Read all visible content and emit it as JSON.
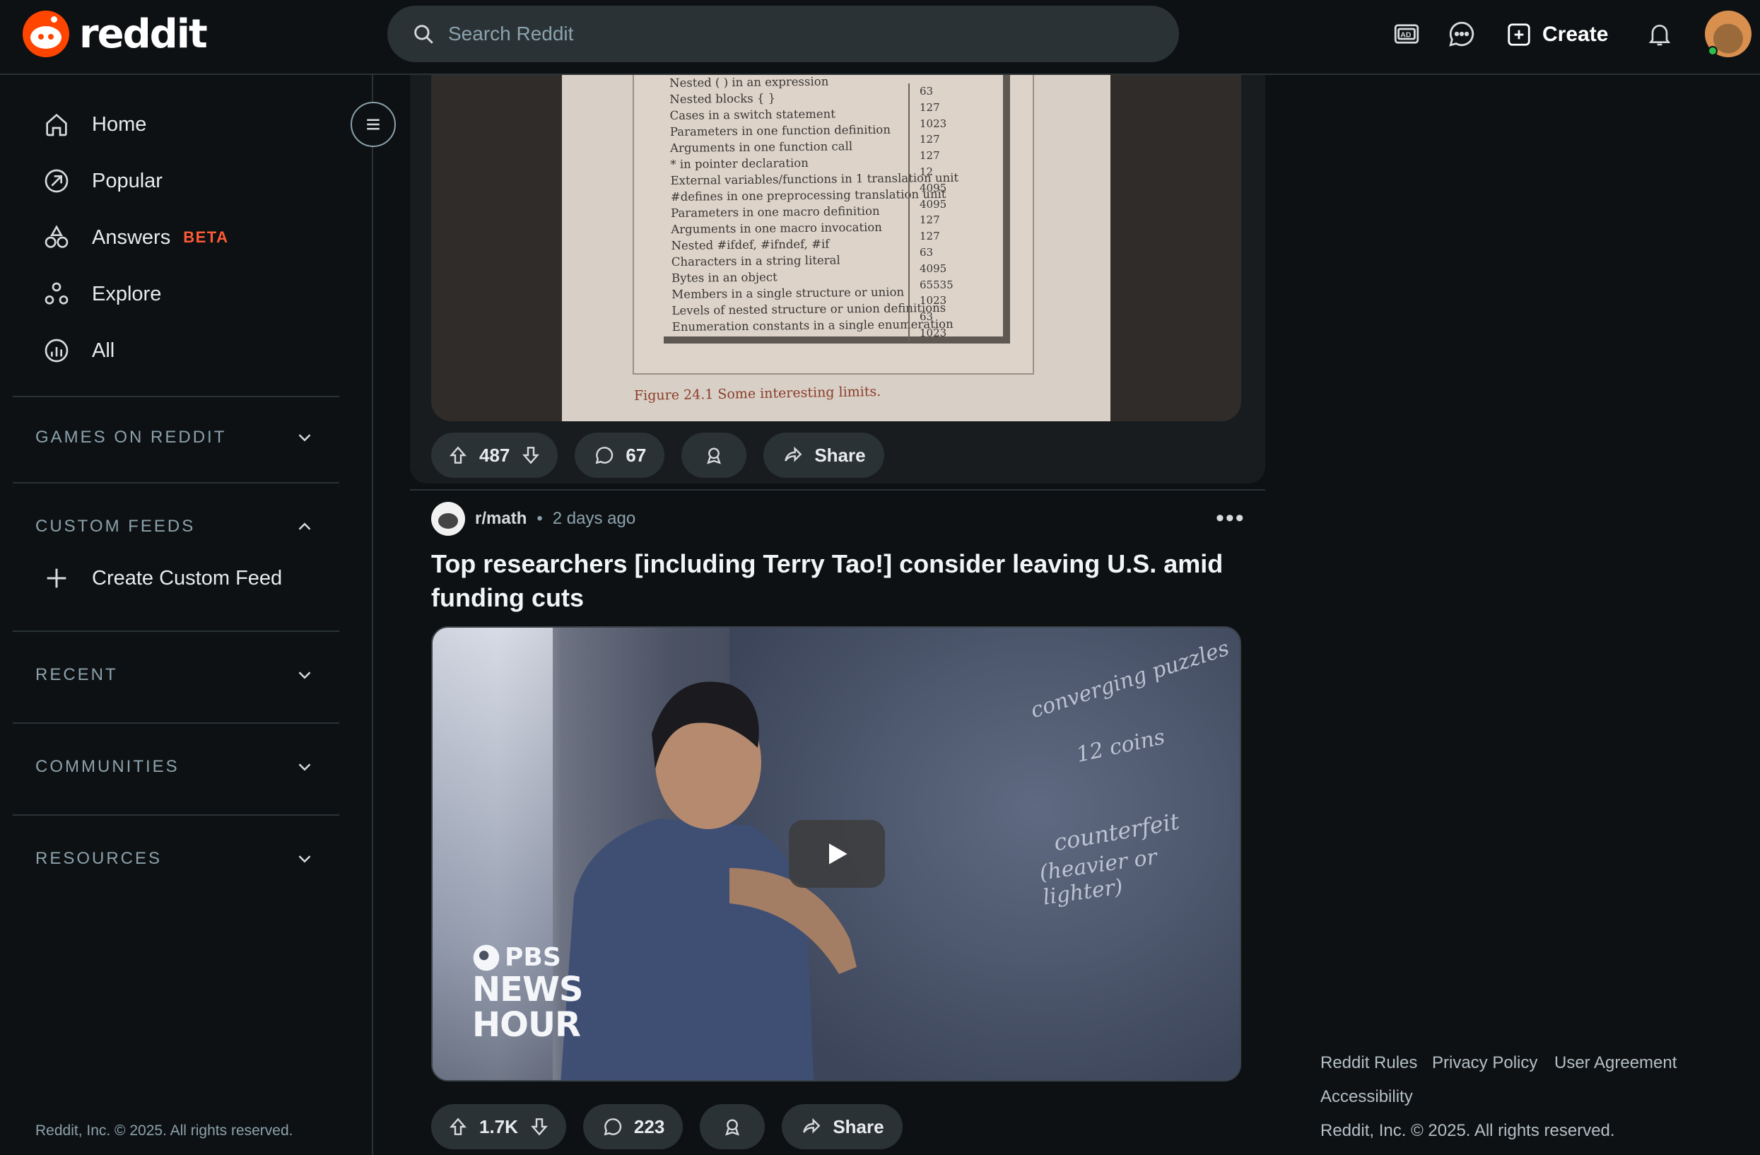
{
  "header": {
    "brand": "reddit",
    "search_placeholder": "Search Reddit",
    "create_label": "Create"
  },
  "sidebar": {
    "nav": [
      {
        "label": "Home",
        "icon": "home-icon"
      },
      {
        "label": "Popular",
        "icon": "popular-icon"
      },
      {
        "label": "Answers",
        "icon": "answers-icon",
        "badge": "BETA"
      },
      {
        "label": "Explore",
        "icon": "explore-icon"
      },
      {
        "label": "All",
        "icon": "all-icon"
      }
    ],
    "sections": [
      "GAMES ON REDDIT",
      "CUSTOM FEEDS",
      "RECENT",
      "COMMUNITIES",
      "RESOURCES"
    ],
    "create_custom_feed": "Create Custom Feed",
    "copyright": "Reddit, Inc. © 2025. All rights reserved."
  },
  "post1": {
    "limits_rows": [
      {
        "label": "Nested ( ) in an expression",
        "value": "63"
      },
      {
        "label": "Nested blocks { }",
        "value": "127"
      },
      {
        "label": "Cases in a switch statement",
        "value": "1023"
      },
      {
        "label": "Parameters in one function definition",
        "value": "127"
      },
      {
        "label": "Arguments in one function call",
        "value": "127"
      },
      {
        "label": "* in pointer declaration",
        "value": "12"
      },
      {
        "label": "External variables/functions in 1 translation unit",
        "value": "4095"
      },
      {
        "label": "#defines in one preprocessing translation unit",
        "value": "4095"
      },
      {
        "label": "Parameters in one macro definition",
        "value": "127"
      },
      {
        "label": "Arguments in one macro invocation",
        "value": "127"
      },
      {
        "label": "Nested #ifdef, #ifndef, #if",
        "value": "63"
      },
      {
        "label": "Characters in a string literal",
        "value": "4095"
      },
      {
        "label": "Bytes in an object",
        "value": "65535"
      },
      {
        "label": "Members in a single structure or union",
        "value": "1023"
      },
      {
        "label": "Levels of nested structure or union definitions",
        "value": "63"
      },
      {
        "label": "Enumeration constants in a single enumeration",
        "value": "1023"
      }
    ],
    "figure_caption": "Figure 24.1  Some interesting limits.",
    "votes": "487",
    "comments": "67",
    "share": "Share"
  },
  "post2": {
    "subreddit": "r/math",
    "dot": "•",
    "time": "2 days ago",
    "more": "•••",
    "title": "Top researchers [including Terry Tao!] consider leaving U.S. amid funding cuts",
    "video_brand_1": "PBS",
    "video_brand_2": "NEWS",
    "video_brand_3": "HOUR",
    "chalk_1": "converging puzzles",
    "chalk_2": "12 coins",
    "chalk_3": "counterfeit",
    "chalk_4": "(heavier or lighter)",
    "votes": "1.7K",
    "comments": "223",
    "share": "Share"
  },
  "right_footer": {
    "links": [
      "Reddit Rules",
      "Privacy Policy",
      "User Agreement",
      "Accessibility"
    ],
    "copyright": "Reddit, Inc. © 2025. All rights reserved."
  },
  "colors": {
    "background": "#0e1113",
    "brand": "#ff4500",
    "beta": "#ff5a36",
    "pill": "#2a3236"
  }
}
